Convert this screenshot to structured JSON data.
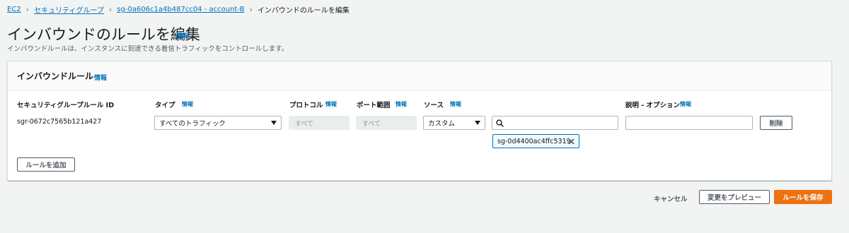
{
  "breadcrumb": {
    "items": [
      "EC2",
      "セキュリティグループ",
      "sg-0a606c1a4b487cc04 - account-B"
    ],
    "current": "インバウンドのルールを編集"
  },
  "page": {
    "title": "インバウンドのルールを編集",
    "info": "情報",
    "description": "インバウンドルールは、インスタンスに到達できる着信トラフィックをコントロールします。"
  },
  "panel": {
    "title": "インバウンドルール",
    "info": "情報",
    "columns": {
      "rule_id": "セキュリティグループルール ID",
      "type": "タイプ",
      "protocol": "プロトコル",
      "port_range": "ポート範囲",
      "source": "ソース",
      "description": "説明 - オプション",
      "info": "情報"
    },
    "row": {
      "rule_id": "sgr-0672c7565b121a427",
      "type": "すべてのトラフィック",
      "protocol": "すべて",
      "port_range": "すべて",
      "source_type": "カスタム",
      "source_search": "",
      "source_token": "sg-0d4400ac4ffc5319c",
      "description": "",
      "delete_label": "削除"
    },
    "add_rule_label": "ルールを追加"
  },
  "footer": {
    "cancel": "キャンセル",
    "preview": "変更をプレビュー",
    "save": "ルールを保存"
  },
  "colors": {
    "link": "#0073bb",
    "primary": "#ec7211",
    "background": "#f2f3f3"
  }
}
